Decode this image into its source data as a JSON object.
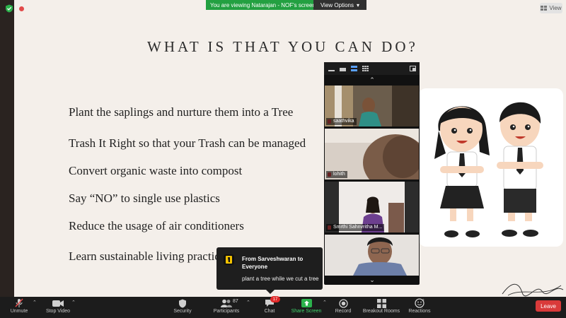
{
  "top_bar": {
    "viewing_text": "You are viewing Natarajan - NOF's screen",
    "view_options": "View Options",
    "view_button": "View"
  },
  "slide": {
    "title": "WHAT IS THAT YOU CAN DO?",
    "bullets": [
      "Plant the saplings and nurture them into a Tree",
      "Trash It Right so that your Trash can be managed",
      "Convert organic waste into compost",
      "Say “NO” to single use plastics",
      "Reduce the usage of air conditioners",
      "Learn sustainable living practices"
    ]
  },
  "video_panel": {
    "participants": [
      {
        "name": "saathvika"
      },
      {
        "name": "lohith"
      },
      {
        "name": "Smrthi  Sahnvritha M..."
      },
      {
        "name": ""
      }
    ]
  },
  "chat_popup": {
    "from": "From Sarveshwaran to Everyone",
    "message": "plant a tree while we cut a tree"
  },
  "toolbar": {
    "unmute": "Unmute",
    "stop_video": "Stop Video",
    "security": "Security",
    "participants": "Participants",
    "participant_count": "87",
    "chat": "Chat",
    "chat_badge": "17",
    "share_screen": "Share Screen",
    "record": "Record",
    "breakout_rooms": "Breakout Rooms",
    "reactions": "Reactions",
    "leave": "Leave"
  },
  "colors": {
    "green": "#23a041",
    "leave_red": "#d93a3a",
    "slide_bg": "#f4efea",
    "share_green": "#3fd36b"
  }
}
